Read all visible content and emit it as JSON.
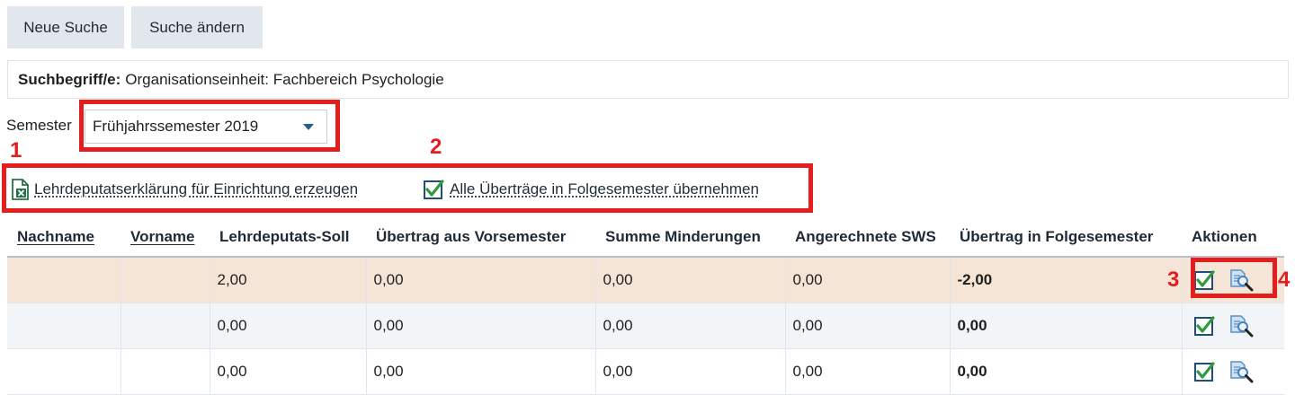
{
  "toolbar": {
    "new_search_label": "Neue Suche",
    "change_search_label": "Suche ändern"
  },
  "search_terms": {
    "label": "Suchbegriff/e:",
    "value": "Organisationseinheit: Fachbereich Psychologie"
  },
  "semester": {
    "label": "Semester",
    "selected": "Frühjahrssemester 2019"
  },
  "actions": {
    "create_declaration": "Lehrdeputatserklärung für Einrichtung erzeugen",
    "transfer_all": "Alle Überträge in Folgesemester übernehmen"
  },
  "annotations": {
    "n1": "1",
    "n2": "2",
    "n3": "3",
    "n4": "4"
  },
  "table": {
    "headers": {
      "nachname": "Nachname",
      "vorname": "Vorname",
      "soll": "Lehrdeputats-Soll",
      "uebertrag_vor": "Übertrag aus Vorsemester",
      "minderungen": "Summe Minderungen",
      "angerechnet": "Angerechnete SWS",
      "uebertrag_folge": "Übertrag in Folgesemester",
      "aktionen": "Aktionen"
    },
    "rows": [
      {
        "nachname": "",
        "vorname": "",
        "soll": "2,00",
        "uebertrag_vor": "0,00",
        "minderungen": "0,00",
        "angerechnet": "0,00",
        "uebertrag_folge": "-2,00"
      },
      {
        "nachname": "",
        "vorname": "",
        "soll": "0,00",
        "uebertrag_vor": "0,00",
        "minderungen": "0,00",
        "angerechnet": "0,00",
        "uebertrag_folge": "0,00"
      },
      {
        "nachname": "",
        "vorname": "",
        "soll": "0,00",
        "uebertrag_vor": "0,00",
        "minderungen": "0,00",
        "angerechnet": "0,00",
        "uebertrag_folge": "0,00"
      }
    ]
  },
  "colors": {
    "highlight_row": "#f4e5d6",
    "alt_row": "#f1f5f8",
    "annotation_red": "#e41d1d",
    "button_bg": "#e1e7ec"
  },
  "icons": [
    "excel-file-icon",
    "checkbox-check-icon",
    "document-search-icon",
    "chevron-down-icon"
  ]
}
